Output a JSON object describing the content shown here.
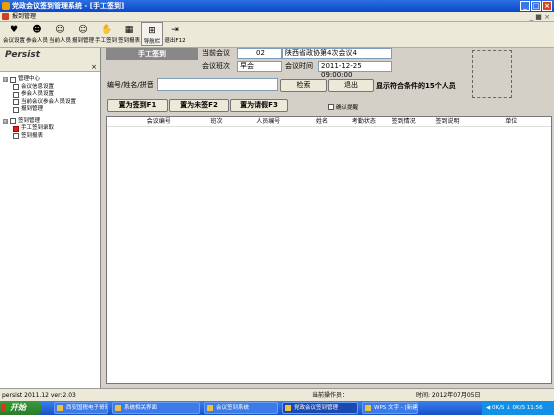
{
  "window": {
    "title": "党政会议签到管理系统 - [手工签到]",
    "min": "_",
    "max": "□",
    "close": "×"
  },
  "menubar": {
    "item": "报到管理",
    "right": "_ ■ ×"
  },
  "toolbar": [
    {
      "icon": "meeting-icon",
      "glyph": "♥",
      "label": "会议设置"
    },
    {
      "icon": "people-icon",
      "glyph": "☻",
      "label": "参会人员"
    },
    {
      "icon": "person-icon",
      "glyph": "☺",
      "label": "当前人员"
    },
    {
      "icon": "smile-icon",
      "glyph": "☺",
      "label": "报到管理"
    },
    {
      "icon": "hand-icon",
      "glyph": "✋",
      "label": "手工签到"
    },
    {
      "icon": "report-icon",
      "glyph": "▦",
      "label": "签到报表"
    },
    {
      "icon": "nav-icon",
      "glyph": "⊞",
      "label": "导航栏"
    },
    {
      "icon": "exit-icon",
      "glyph": "⇥",
      "label": "退出F12"
    }
  ],
  "sidebar": {
    "title": "Persist",
    "close": "×",
    "tree": [
      {
        "level": 0,
        "expander": "⊟",
        "label": "管理中心"
      },
      {
        "level": 1,
        "label": "会议信息设置"
      },
      {
        "level": 1,
        "label": "参会人员设置"
      },
      {
        "level": 1,
        "label": "当前会议参会人员设置"
      },
      {
        "level": 1,
        "label": "报到管理"
      },
      {
        "level": 0,
        "expander": "⊟",
        "label": "签到管理"
      },
      {
        "level": 1,
        "label": "手工签到录取",
        "checked": true
      },
      {
        "level": 1,
        "label": "签到报表"
      }
    ]
  },
  "main": {
    "section_label": "手工签到",
    "current_meeting_label": "当前会议",
    "meeting_no": "02",
    "meeting_name": "陕西省政协第4次会议4",
    "session_label": "会议班次",
    "session_value": "早会",
    "time_label": "会议时间",
    "time_value": "2011-12-25 09:00:00",
    "search_label": "编号/姓名/拼音",
    "search_value": "",
    "search_button": "检索",
    "exit_button": "退出",
    "result_text": "显示符合条件的15个人员",
    "btn_signed": "置为签到F1",
    "btn_unsigned": "置为未签F2",
    "btn_leave": "置为请假F3",
    "confirm_checkbox": "确认提醒",
    "columns": [
      "会议编号",
      "班次",
      "人员编号",
      "姓名",
      "考勤状态",
      "签到情况",
      "签到说明",
      "单位"
    ]
  },
  "statusbar": {
    "version": "persist 2011.12 ver:2.03",
    "operator": "当前操作员：",
    "time": "时间: 2012年07月05日"
  },
  "taskbar": {
    "start": "开始",
    "tasks": [
      "西安国税电子哥哥",
      "系统相关界面",
      "会议签到系统",
      "党政会议签到管理",
      "WPS 文字 - [新建]"
    ],
    "active": 3,
    "tray": "◀ 0K/S ↓ 0K/S 11:56"
  },
  "colors": {
    "titlebar": "#0a48c8",
    "taskbar": "#1650c8",
    "start": "#2a7a2a"
  }
}
